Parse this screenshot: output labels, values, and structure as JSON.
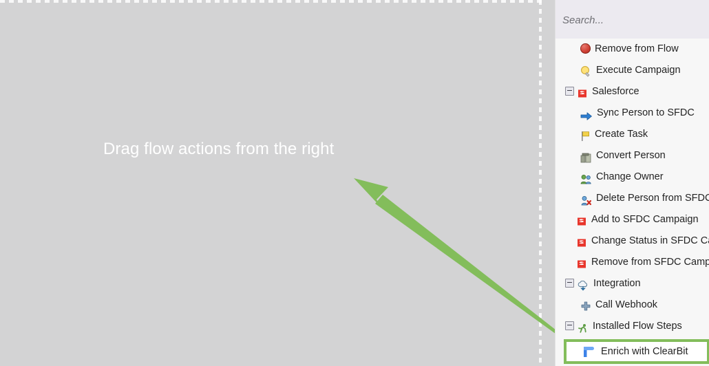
{
  "canvas": {
    "hint_text": "Drag flow actions from the right",
    "background_color": "#d3d3d4",
    "hint_color": "#ffffff"
  },
  "annotation": {
    "arrow_color": "#83bd5b",
    "arrow_tip": "514,259",
    "arrow_tail": "818,493"
  },
  "panel": {
    "search": {
      "placeholder": "Search...",
      "value": ""
    },
    "tree": [
      {
        "label": "Remove from Flow",
        "icon": "red-circle-icon",
        "level": "leaf",
        "type": "action"
      },
      {
        "label": "Execute Campaign",
        "icon": "lightbulb-icon",
        "level": "leaf",
        "type": "action"
      },
      {
        "label": "Salesforce",
        "icon": "salesforce-icon",
        "level": "group",
        "type": "group",
        "expander": "minus"
      },
      {
        "label": "Sync Person to SFDC",
        "icon": "blue-arrow-icon",
        "level": "leaf",
        "type": "action"
      },
      {
        "label": "Create Task",
        "icon": "flag-icon",
        "level": "leaf",
        "type": "action"
      },
      {
        "label": "Convert Person",
        "icon": "convert-person-icon",
        "level": "leaf",
        "type": "action"
      },
      {
        "label": "Change Owner",
        "icon": "change-owner-icon",
        "level": "leaf",
        "type": "action"
      },
      {
        "label": "Delete Person from SFDC",
        "icon": "delete-person-icon",
        "level": "leaf",
        "type": "action"
      },
      {
        "label": "Add to SFDC Campaign",
        "icon": "salesforce-icon",
        "level": "leaf2",
        "type": "action"
      },
      {
        "label": "Change Status in SFDC Campaign",
        "icon": "salesforce-icon",
        "level": "leaf2",
        "type": "action"
      },
      {
        "label": "Remove from SFDC Campaign",
        "icon": "salesforce-icon",
        "level": "leaf2",
        "type": "action"
      },
      {
        "label": "Integration",
        "icon": "cloud-icon",
        "level": "group",
        "type": "group",
        "expander": "minus"
      },
      {
        "label": "Call Webhook",
        "icon": "webhook-icon",
        "level": "leaf",
        "type": "action"
      },
      {
        "label": "Installed Flow Steps",
        "icon": "runner-icon",
        "level": "group",
        "type": "group",
        "expander": "minus"
      }
    ],
    "highlighted_item": {
      "label": "Enrich with ClearBit",
      "icon": "clearbit-icon",
      "border_color": "#83bd5b",
      "background_color": "#ffffff"
    }
  }
}
